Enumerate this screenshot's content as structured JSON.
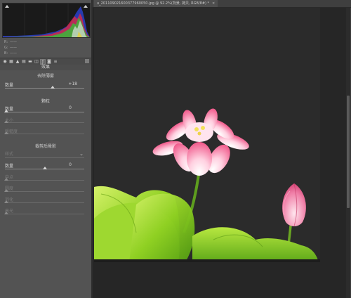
{
  "tab": {
    "title": "u_201109021600377960050.jpg @ 92.2%(背景, 拷贝, RGB/8#) *",
    "close": "×"
  },
  "histogram": {
    "readouts": [
      {
        "label": "R:",
        "value": "——"
      },
      {
        "label": "G:",
        "value": "——"
      },
      {
        "label": "B:",
        "value": "——"
      }
    ]
  },
  "toolbar": {
    "icons": [
      "aperture-icon",
      "tone-curve-icon",
      "mountain-icon",
      "grid-icon",
      "split-toning-icon",
      "lens-icon",
      "fx-icon",
      "camera-icon",
      "presets-icon"
    ],
    "active": "fx-icon"
  },
  "panel": {
    "title": "效果",
    "dehaze": {
      "title": "去除薄雾",
      "amount_label": "数量",
      "amount_value": "+18",
      "level": 0.55
    },
    "grain": {
      "title": "颗粒",
      "amount_label": "数量",
      "amount_value": "0",
      "size_label": "大小",
      "roughness_label": "粗糙度"
    },
    "vignette": {
      "title": "裁剪后晕影",
      "style_label": "样式",
      "style_value": "",
      "amount_label": "数量",
      "amount_value": "0",
      "midpoint_label": "中点",
      "roundness_label": "圆度",
      "feather_label": "羽化",
      "highlights_label": "高光"
    }
  },
  "colors": {
    "panel_bg": "#535353",
    "canvas_bg": "#262626",
    "photo_bg": "#2b2b2b"
  }
}
